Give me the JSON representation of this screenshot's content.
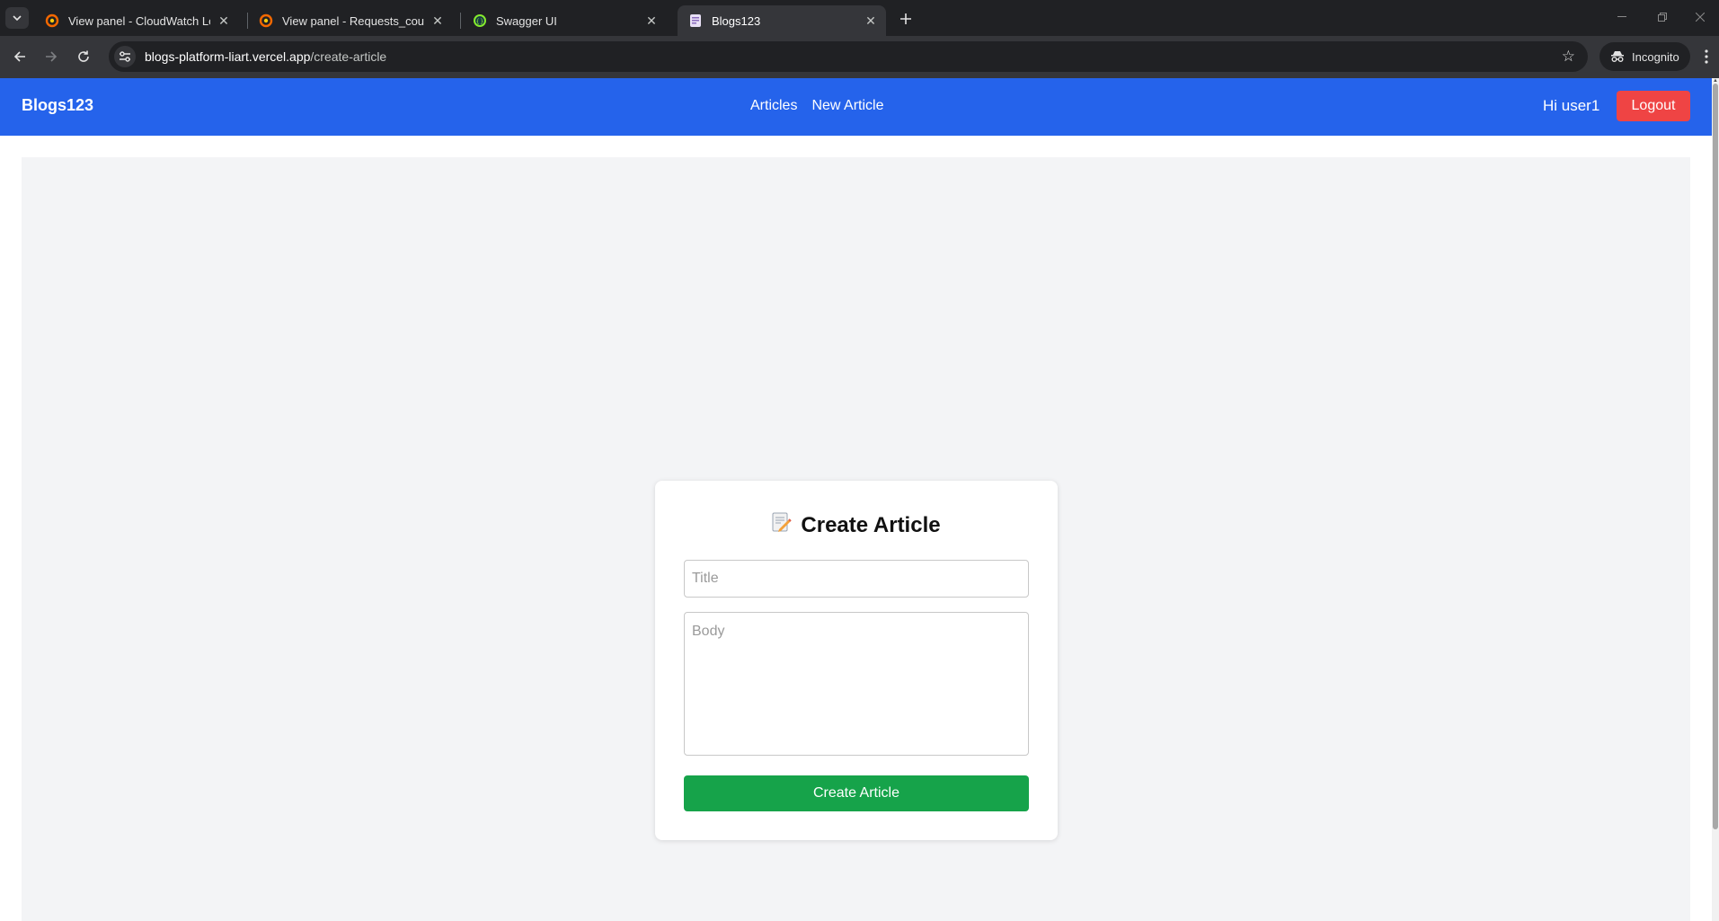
{
  "browser": {
    "tabs": [
      {
        "title": "View panel - CloudWatch Logs",
        "icon": "grafana-icon"
      },
      {
        "title": "View panel - Requests_count - G",
        "icon": "grafana-icon"
      },
      {
        "title": "Swagger UI",
        "icon": "swagger-icon"
      },
      {
        "title": "Blogs123",
        "icon": "page-icon",
        "active": true
      }
    ],
    "url_host": "blogs-platform-liart.vercel.app",
    "url_path": "/create-article",
    "incognito_label": "Incognito"
  },
  "app": {
    "brand": "Blogs123",
    "nav": {
      "articles": "Articles",
      "new_article": "New Article"
    },
    "greeting": "Hi user1",
    "logout_label": "Logout",
    "colors": {
      "nav": "#2563eb",
      "logout": "#ef4444",
      "submit": "#16a34a",
      "background": "#f3f4f6"
    }
  },
  "form": {
    "emoji": "📝",
    "heading": "Create Article",
    "title_placeholder": "Title",
    "title_value": "",
    "body_placeholder": "Body",
    "body_value": "",
    "submit_label": "Create Article"
  }
}
